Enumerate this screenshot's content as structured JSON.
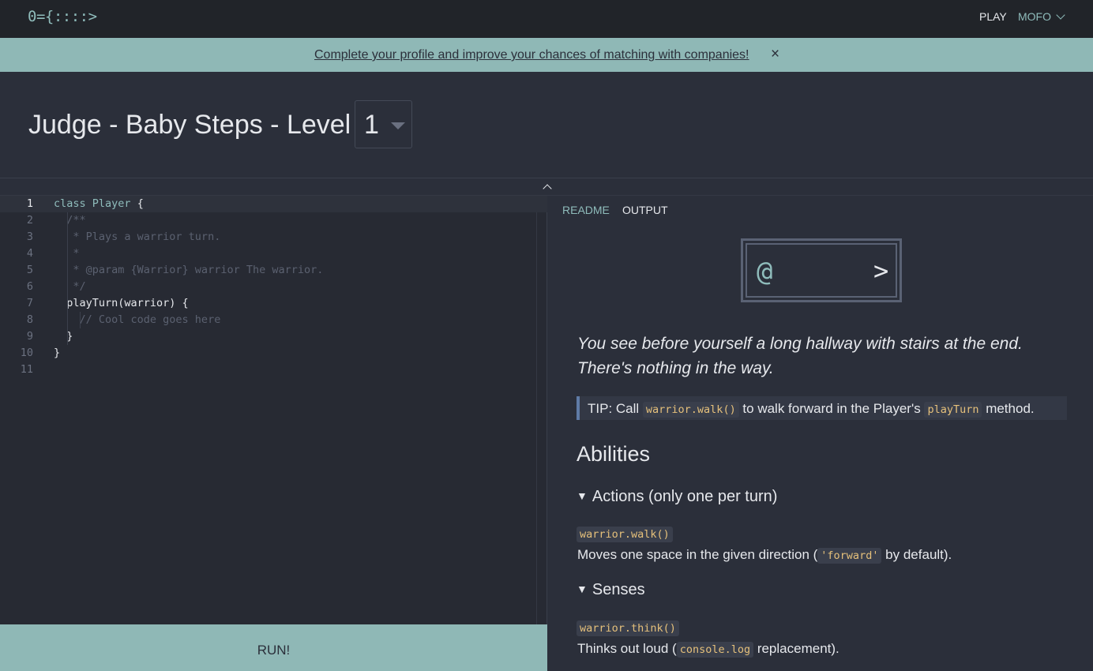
{
  "header": {
    "logo": "0={::::>",
    "nav_play": "PLAY",
    "nav_user": "MOFO"
  },
  "banner": {
    "text": "Complete your profile and improve your chances of matching with companies!",
    "close": "×"
  },
  "page": {
    "title": "Judge - Baby Steps - Level",
    "level_value": "1"
  },
  "editor": {
    "line_numbers": [
      "1",
      "2",
      "3",
      "4",
      "5",
      "6",
      "7",
      "8",
      "9",
      "10",
      "11"
    ],
    "lines": [
      [
        {
          "t": "kw",
          "v": "class"
        },
        {
          "t": "pl",
          "v": " "
        },
        {
          "t": "cl",
          "v": "Player"
        },
        {
          "t": "pl",
          "v": " {"
        }
      ],
      [
        {
          "t": "cm",
          "v": "  /**"
        }
      ],
      [
        {
          "t": "cm",
          "v": "   * Plays a warrior turn."
        }
      ],
      [
        {
          "t": "cm",
          "v": "   *"
        }
      ],
      [
        {
          "t": "cm",
          "v": "   * @param {Warrior} warrior The warrior."
        }
      ],
      [
        {
          "t": "cm",
          "v": "   */"
        }
      ],
      [
        {
          "t": "pl",
          "v": "  playTurn(warrior) {"
        }
      ],
      [
        {
          "t": "cm",
          "v": "    // Cool code goes here"
        }
      ],
      [
        {
          "t": "pl",
          "v": "  }"
        }
      ],
      [
        {
          "t": "pl",
          "v": "}"
        }
      ],
      [
        {
          "t": "pl",
          "v": ""
        }
      ]
    ],
    "run_label": "RUN!"
  },
  "panel": {
    "tab_readme": "README",
    "tab_output": "OUTPUT",
    "board_warrior": "@",
    "board_stairs": ">",
    "description_1": "You see before yourself a long hallway with stairs at the end.",
    "description_2": "There's nothing in the way.",
    "tip_prefix": "TIP: Call ",
    "tip_code_1": "warrior.walk()",
    "tip_mid": " to walk forward in the Player's ",
    "tip_code_2": "playTurn",
    "tip_suffix": " method.",
    "abilities_heading": "Abilities",
    "actions_heading": "Actions (only one per turn)",
    "walk_code": "warrior.walk()",
    "walk_desc_prefix": "Moves one space in the given direction (",
    "walk_desc_code": "'forward'",
    "walk_desc_suffix": " by default).",
    "senses_heading": "Senses",
    "think_code": "warrior.think()",
    "think_desc_prefix": "Thinks out loud (",
    "think_desc_code": "console.log",
    "think_desc_suffix": " replacement)."
  }
}
